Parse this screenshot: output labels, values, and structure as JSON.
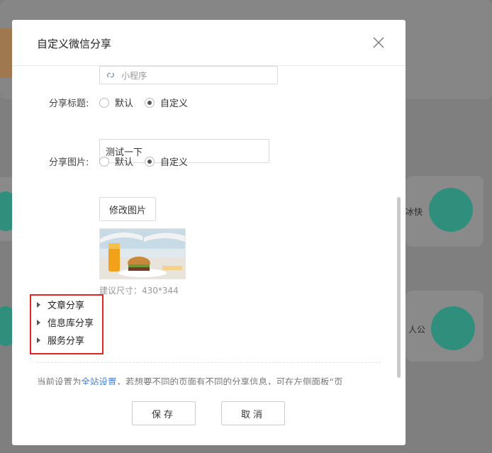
{
  "modal": {
    "title": "自定义微信分享",
    "mini_program_placeholder": "小程序",
    "share_title": {
      "label": "分享标题:",
      "options": [
        "默认",
        "自定义"
      ],
      "selected": "自定义",
      "value": "测试一下"
    },
    "share_image": {
      "label": "分享图片:",
      "options": [
        "默认",
        "自定义"
      ],
      "selected": "自定义",
      "modify_button": "修改图片",
      "hint": "建议尺寸：430*344"
    },
    "collapse_items": [
      "文章分享",
      "信息库分享",
      "服务分享"
    ],
    "note": {
      "prefix": "当前设置为",
      "link": "全站设置",
      "suffix": "，若想要不同的页面有不同的分享信息，可在左侧面板“页面”-“分享”中,对单个页面进行自定义设置。"
    },
    "footer": {
      "save": "保存",
      "cancel": "取消"
    }
  },
  "background": {
    "text_1": "冰快",
    "text_2": "人公"
  },
  "colors": {
    "accent_link": "#3d7fd8",
    "highlight": "#e52323",
    "bg_teal": "#2f8f7c"
  }
}
